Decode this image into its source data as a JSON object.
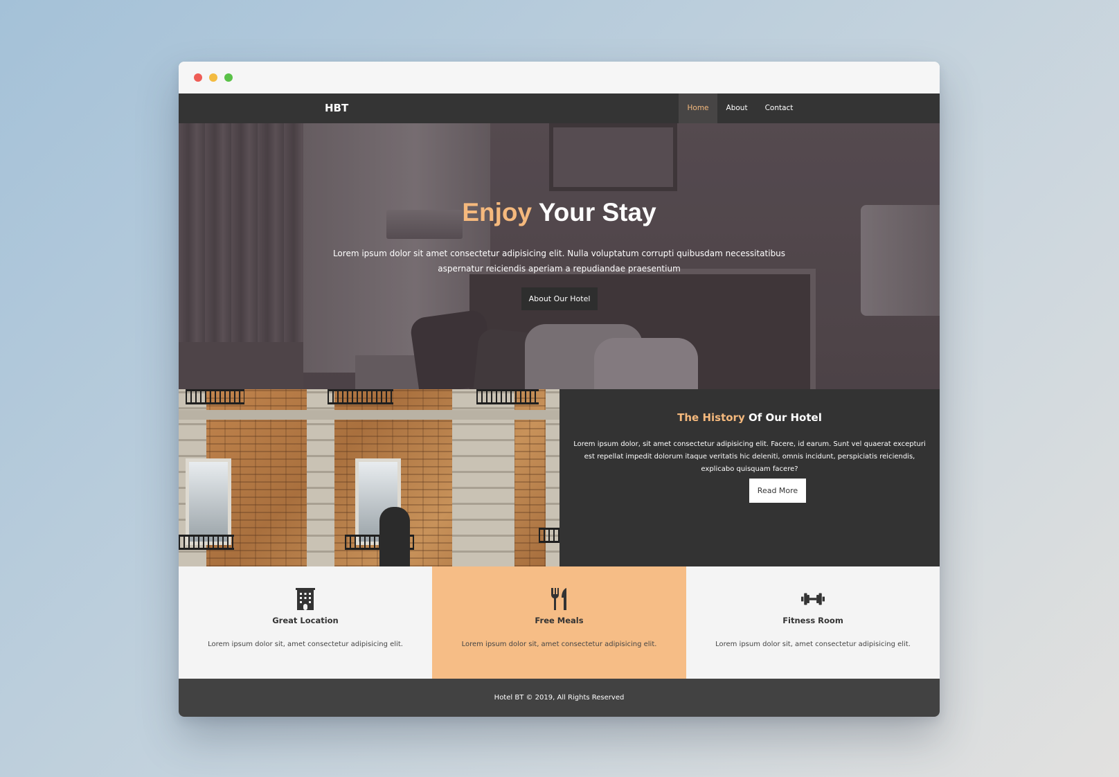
{
  "window": {
    "controls": [
      "close",
      "minimize",
      "maximize"
    ]
  },
  "navbar": {
    "brand": "HBT",
    "links": [
      {
        "label": "Home",
        "active": true
      },
      {
        "label": "About",
        "active": false
      },
      {
        "label": "Contact",
        "active": false
      }
    ]
  },
  "hero": {
    "title_accent": "Enjoy",
    "title_rest": " Your Stay",
    "text": "Lorem ipsum dolor sit amet consectetur adipisicing elit. Nulla voluptatum corrupti quibusdam necessitatibus aspernatur reiciendis aperiam a repudiandae praesentium",
    "button_label": "About Our Hotel"
  },
  "history": {
    "title_accent": "The History",
    "title_rest": " Of Our Hotel",
    "text": "Lorem ipsum dolor, sit amet consectetur adipisicing elit. Facere, id earum. Sunt vel quaerat excepturi est repellat impedit dolorum itaque veritatis hic deleniti, omnis incidunt, perspiciatis reiciendis, explicabo quisquam facere?",
    "button_label": "Read More"
  },
  "features": [
    {
      "icon": "building-icon",
      "title": "Great Location",
      "text": "Lorem ipsum dolor sit, amet consectetur adipisicing elit."
    },
    {
      "icon": "utensils-icon",
      "title": "Free Meals",
      "text": "Lorem ipsum dolor sit, amet consectetur adipisicing elit."
    },
    {
      "icon": "dumbbell-icon",
      "title": "Fitness Room",
      "text": "Lorem ipsum dolor sit, amet consectetur adipisicing elit."
    }
  ],
  "footer": {
    "text": "Hotel BT © 2019, All Rights Reserved"
  },
  "colors": {
    "accent": "#f5b97d",
    "dark": "#333333",
    "navbar": "#343434",
    "footer": "#424242",
    "feature_highlight": "#f6bd86"
  }
}
